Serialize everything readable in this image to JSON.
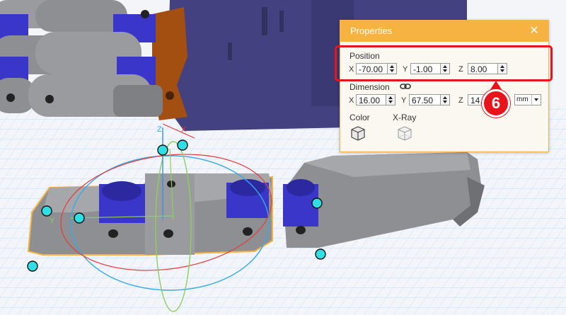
{
  "panel": {
    "title": "Properties",
    "close_icon": "close-icon",
    "position": {
      "label": "Position",
      "x_label": "X",
      "x_value": "-70.00",
      "y_label": "Y",
      "y_value": "-1.00",
      "z_label": "Z",
      "z_value": "8.00"
    },
    "dimension": {
      "label": "Dimension",
      "link_icon": "link-icon",
      "x_label": "X",
      "x_value": "16.00",
      "y_label": "Y",
      "y_value": "67.50",
      "z_label": "Z",
      "z_value": "14.0",
      "unit": "mm"
    },
    "color_label": "Color",
    "xray_label": "X-Ray"
  },
  "annotation": {
    "step": "6",
    "color": "#e8141c"
  },
  "viewport": {
    "axis_labels": {
      "z": "Z",
      "x": "X",
      "y": "Y"
    },
    "colors": {
      "model_gray": "#8e8f92",
      "model_blue": "#3a36c9",
      "grid": "#8fc8f0",
      "selection": "#f6b341",
      "handle": "#2ee0e6"
    }
  }
}
